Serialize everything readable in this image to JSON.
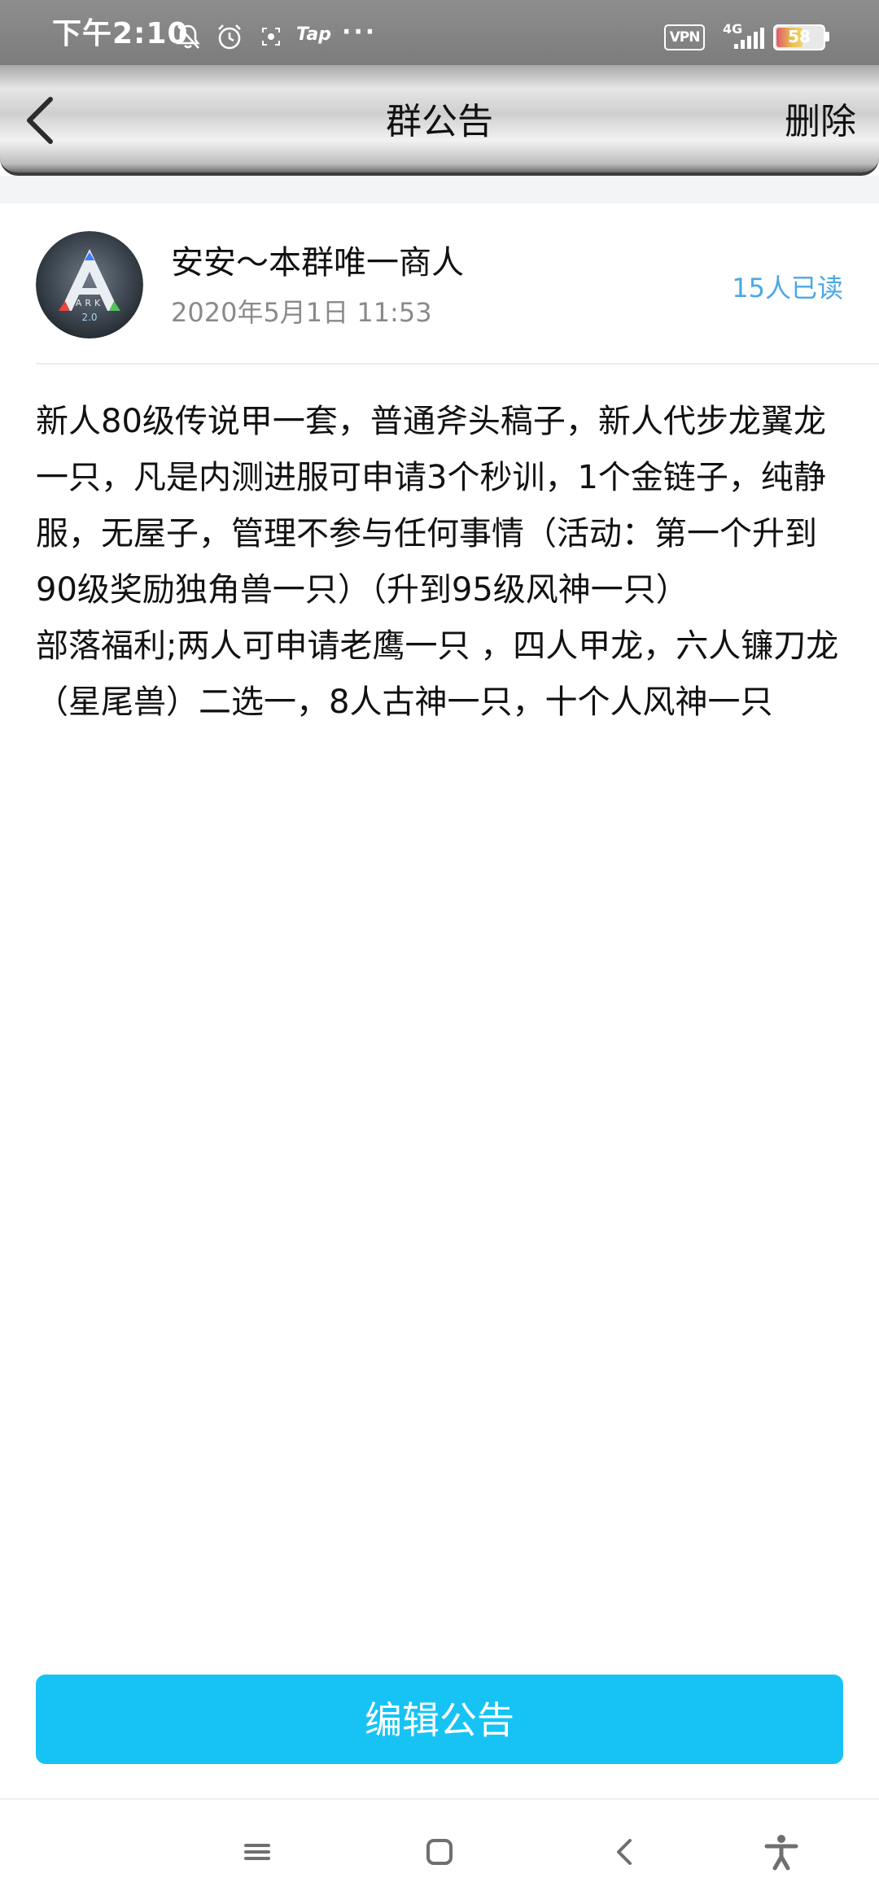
{
  "status_bar": {
    "time": "下午2:10",
    "tap_label": "Tap",
    "more_dots": "···",
    "vpn_label": "VPN",
    "network_label": "4G",
    "battery_level": "58",
    "icons": [
      "mute-bell-icon",
      "alarm-icon",
      "screen-record-icon",
      "signal-icon",
      "battery-icon"
    ]
  },
  "nav_bar": {
    "title": "群公告",
    "delete_label": "删除",
    "back_icon": "chevron-left-icon"
  },
  "announcement": {
    "author_name": "安安～本群唯一商人",
    "avatar_logo_text": "ARK 2.0",
    "post_time": "2020年5月1日 11:53",
    "read_count": "15人已读",
    "paragraphs": [
      "新人80级传说甲一套，普通斧头稿子，新人代步龙翼龙一只，凡是内测进服可申请3个秒训，1个金链子，纯静服，无屋子，管理不参与任何事情（活动：第一个升到90级奖励独角兽一只）（升到95级风神一只）",
      "部落福利;两人可申请老鹰一只 ，四人甲龙，六人镰刀龙（星尾兽）二选一，8人古神一只，十个人风神一只"
    ]
  },
  "edit_button": {
    "label": "编辑公告",
    "color": "#17c3f5"
  },
  "system_nav": {
    "icons": [
      "menu-icon",
      "home-square-icon",
      "back-chevron-icon",
      "accessibility-icon"
    ]
  },
  "colors": {
    "read_count": "#4da7e6",
    "time_text": "#8a8a8a",
    "status_bar": "#858585"
  }
}
